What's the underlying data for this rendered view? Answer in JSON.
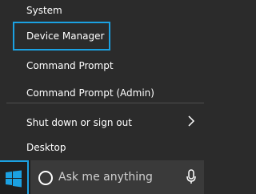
{
  "menu": {
    "items": [
      {
        "label": "System"
      },
      {
        "label": "Device Manager"
      },
      {
        "label": "Command Prompt"
      },
      {
        "label": "Command Prompt (Admin)"
      },
      {
        "label": "Shut down or sign out"
      },
      {
        "label": "Desktop"
      }
    ]
  },
  "taskbar": {
    "search_placeholder": "Ask me anything"
  },
  "colors": {
    "accent": "#1ba1e2",
    "menu_bg": "#2b2b2b",
    "taskbar_bg": "#1f1f1f"
  },
  "icons": {
    "start": "windows-logo-icon",
    "search": "search-circle-icon",
    "mic": "microphone-icon",
    "submenu": "chevron-right-icon"
  }
}
